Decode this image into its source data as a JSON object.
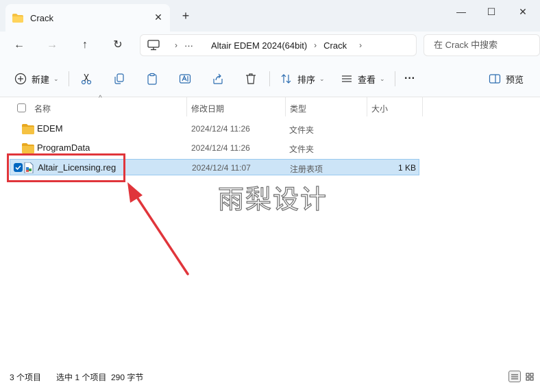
{
  "window": {
    "tab_title": "Crack",
    "tab_close": "✕",
    "new_tab": "+",
    "minimize": "—",
    "maximize": "☐",
    "close": "✕"
  },
  "nav": {
    "back": "←",
    "forward": "→",
    "up": "↑",
    "refresh": "↻",
    "breadcrumb": [
      "Altair EDEM 2024(64bit)",
      "Crack"
    ],
    "overflow": "···",
    "search_placeholder": "在 Crack 中搜索"
  },
  "toolbar": {
    "new_label": "新建",
    "sort_label": "排序",
    "view_label": "查看",
    "more_label": "···",
    "preview_label": "预览"
  },
  "columns": {
    "name": "名称",
    "date": "修改日期",
    "type": "类型",
    "size": "大小"
  },
  "files": [
    {
      "name": "EDEM",
      "date": "2024/12/4 11:26",
      "type": "文件夹",
      "size": "",
      "kind": "folder-icon",
      "selected": false
    },
    {
      "name": "ProgramData",
      "date": "2024/12/4 11:26",
      "type": "文件夹",
      "size": "",
      "kind": "folder-icon",
      "selected": false
    },
    {
      "name": "Altair_Licensing.reg",
      "date": "2024/12/4 11:07",
      "type": "注册表项",
      "size": "1 KB",
      "kind": "reg-file-icon",
      "selected": true
    }
  ],
  "watermark": "雨梨设计",
  "status": {
    "item_count": "3 个项目",
    "selection": "选中 1 个项目  290 字节"
  },
  "colors": {
    "accent": "#0067c0",
    "selection_bg": "#cce4f7",
    "annotation_red": "#e0353b",
    "folder_yellow": "#f5c242"
  }
}
